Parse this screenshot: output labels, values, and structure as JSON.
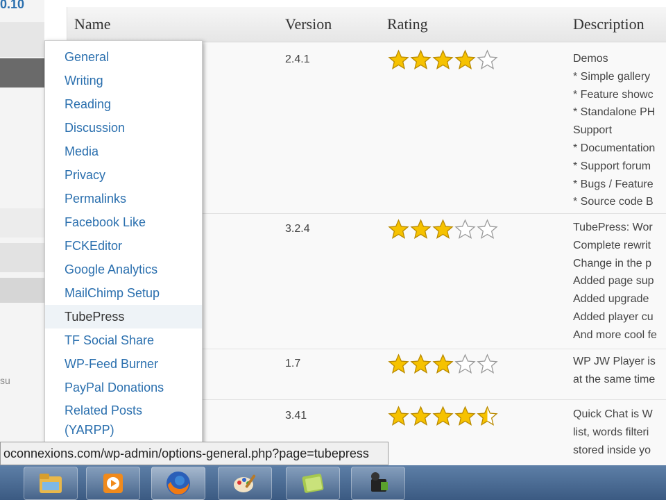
{
  "sidebar": {
    "version_fragment": "0.10",
    "user_fragment": "su"
  },
  "table": {
    "headers": {
      "name": "Name",
      "version": "Version",
      "rating": "Rating",
      "description": "Description"
    },
    "rows": [
      {
        "version": "2.4.1",
        "rating": 4,
        "rating_max": 5,
        "description": [
          "Demos",
          "* Simple gallery",
          "* Feature showc",
          "* Standalone PH",
          "Support",
          "* Documentation",
          "* Support forum",
          "* Bugs / Feature",
          "* Source code B"
        ]
      },
      {
        "version": "3.2.4",
        "rating": 3,
        "rating_max": 5,
        "description": [
          "TubePress: Wor",
          "Complete rewrit",
          "Change in the p",
          "Added page sup",
          "Added upgrade",
          "Added player cu",
          "And more cool fe"
        ]
      },
      {
        "version": "1.7",
        "rating": 3,
        "rating_max": 5,
        "description": [
          "WP JW Player is",
          "at the same time"
        ]
      },
      {
        "version": "3.41",
        "rating": 4.5,
        "rating_max": 5,
        "description": [
          "Quick Chat is W",
          "list, words filteri",
          "stored inside yo"
        ]
      }
    ]
  },
  "menu": {
    "items": [
      "General",
      "Writing",
      "Reading",
      "Discussion",
      "Media",
      "Privacy",
      "Permalinks",
      "Facebook Like",
      "FCKEditor",
      "Google Analytics",
      "MailChimp Setup",
      "TubePress",
      "TF Social Share",
      "WP-Feed Burner",
      "PayPal Donations",
      "Related Posts (YARPP)"
    ],
    "active": "TubePress"
  },
  "status_url": "oconnexions.com/wp-admin/options-general.php?page=tubepress",
  "taskbar": [
    "explorer-folder-icon",
    "media-player-icon",
    "firefox-icon",
    "paint-icon",
    "notes-icon",
    "camera-icon"
  ],
  "colors": {
    "link": "#2a6fae",
    "star": "#f6c200",
    "taskbar": "#4a6a92"
  }
}
